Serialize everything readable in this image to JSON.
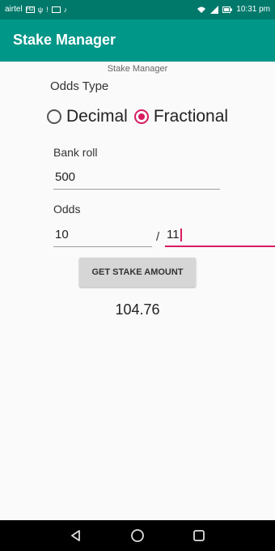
{
  "status_bar": {
    "carrier": "airtel",
    "time": "10:31 pm",
    "icons": [
      "hd-icon",
      "usb-icon",
      "notification-icon",
      "image-icon",
      "tiktok-icon",
      "wifi-icon",
      "signal-icon",
      "battery-icon"
    ]
  },
  "app_bar": {
    "title": "Stake Manager"
  },
  "main": {
    "subtitle": "Stake Manager",
    "odds_type_label": "Odds Type",
    "radio_options": [
      {
        "label": "Decimal",
        "checked": false
      },
      {
        "label": "Fractional",
        "checked": true
      }
    ],
    "bankroll": {
      "label": "Bank roll",
      "value": "500"
    },
    "odds": {
      "label": "Odds",
      "numerator": "10",
      "separator": "/",
      "denominator": "11"
    },
    "button_label": "GET STAKE AMOUNT",
    "result": "104.76"
  },
  "nav_bar": {
    "buttons": [
      "back-icon",
      "home-icon",
      "recents-icon"
    ]
  },
  "colors": {
    "status_bar": "#00796b",
    "app_bar": "#009688",
    "accent": "#d81b60",
    "background": "#fafafa"
  }
}
